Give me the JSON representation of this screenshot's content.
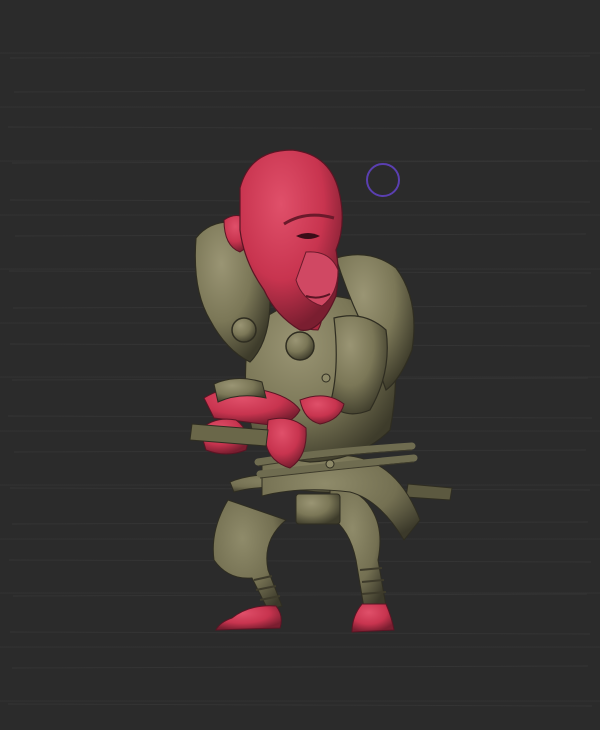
{
  "viewport": {
    "background_color": "#2b2b2b",
    "brush_cursor_color": "#5a3fb0"
  },
  "model": {
    "skin_color": "#c8344f",
    "armor_color": "#7b7757",
    "cloth_color": "#777355",
    "rope_color": "#6f6c50"
  }
}
